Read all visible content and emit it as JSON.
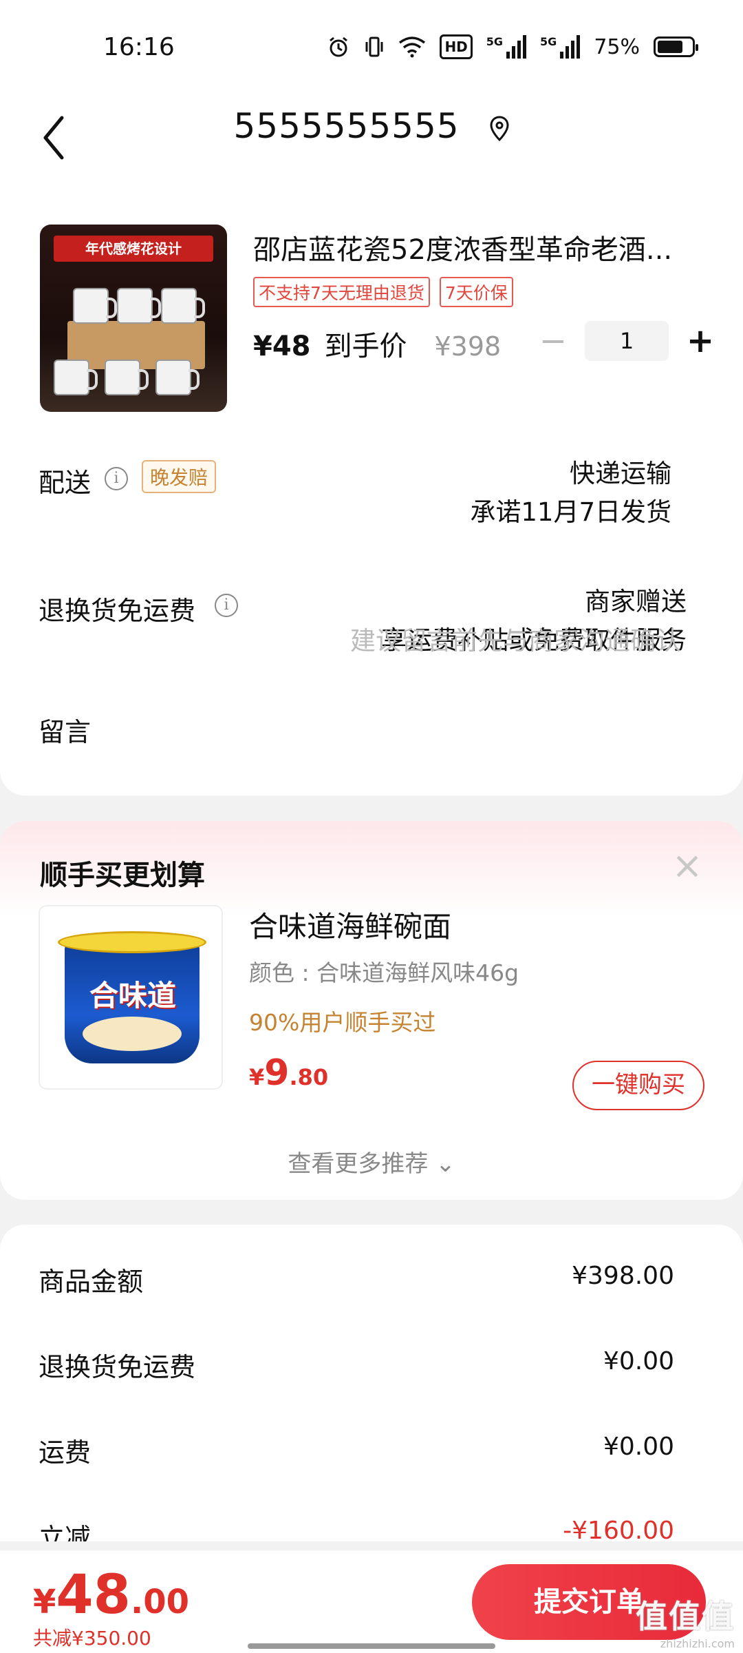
{
  "status_bar": {
    "time": "16:16",
    "battery": "75%",
    "signal_label": "5G",
    "hd_label": "HD",
    "battery_level": 0.75
  },
  "header": {
    "address": "5555555555"
  },
  "product": {
    "title": "邵店蓝花瓷52度浓香型革命老酒...",
    "image_banner": "年代感烤花设计",
    "tags": [
      "不支持7天无理由退货",
      "7天价保"
    ],
    "price": "¥48",
    "price_label": "到手价",
    "original_price": "¥398",
    "quantity": "1",
    "minus_label": "−",
    "plus_label": "+"
  },
  "delivery": {
    "label": "配送",
    "info_icon": "info-icon",
    "late_tag": "晚发赔",
    "method": "快递运输",
    "promise": "承诺11月7日发货"
  },
  "return_shipping": {
    "label": "退换货免运费",
    "value": "商家赠送",
    "desc": "享运费补贴或免费取件服务"
  },
  "message": {
    "label": "留言",
    "placeholder": "建议留言前先与商家沟通确认"
  },
  "recommend": {
    "title": "顺手买更划算",
    "close_label": "×",
    "item": {
      "name": "合味道海鲜碗面",
      "image_text": "合味道",
      "spec": "颜色 : 合味道海鲜风味46g",
      "social": "90%用户顺手买过",
      "price_currency": "¥",
      "price_int": "9",
      "price_dec": ".80",
      "buy_label": "一键购买"
    },
    "more_label": "查看更多推荐 ⌄"
  },
  "summary": {
    "rows": [
      {
        "label": "商品金额",
        "value": "¥398.00"
      },
      {
        "label": "退换货免运费",
        "value": "¥0.00"
      },
      {
        "label": "运费",
        "value": "¥0.00"
      },
      {
        "label": "立减",
        "value": "-¥160.00"
      }
    ]
  },
  "footer": {
    "total_currency": "¥",
    "total_int": "48",
    "total_dec": ".00",
    "saved": "共减¥350.00",
    "submit_label": "提交订单",
    "watermark": "值值值",
    "watermark_sub": "zhizhizhi.com"
  },
  "colors": {
    "accent_red": "#e0302a",
    "late_tag": "#c58230"
  }
}
